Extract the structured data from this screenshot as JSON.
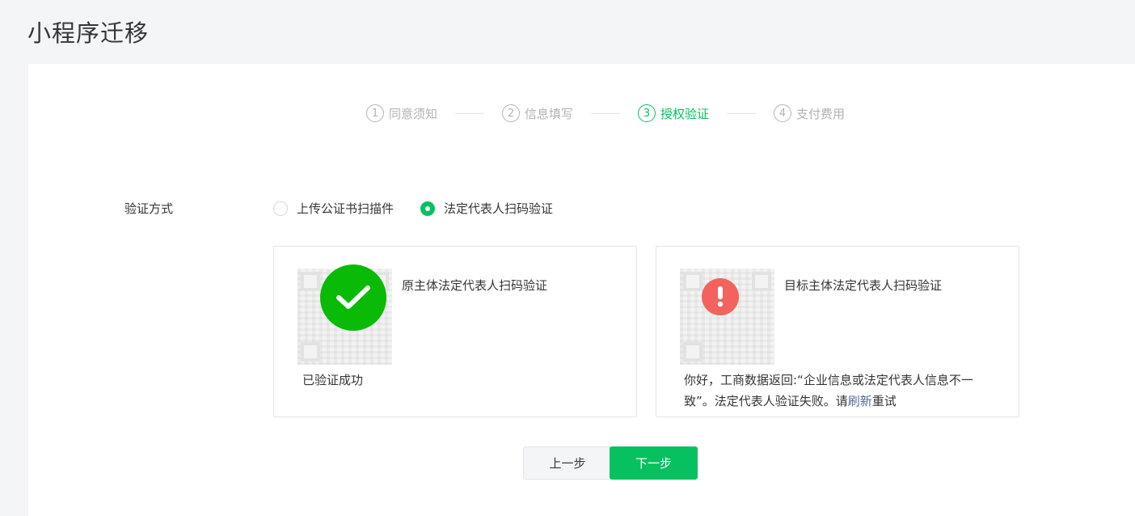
{
  "page": {
    "title": "小程序迁移"
  },
  "steps": [
    {
      "num": "1",
      "label": "同意须知"
    },
    {
      "num": "2",
      "label": "信息填写"
    },
    {
      "num": "3",
      "label": "授权验证"
    },
    {
      "num": "4",
      "label": "支付费用"
    }
  ],
  "active_step": 3,
  "form": {
    "label": "验证方式",
    "options": [
      {
        "label": "上传公证书扫描件",
        "selected": false
      },
      {
        "label": "法定代表人扫码验证",
        "selected": true
      }
    ]
  },
  "cards": {
    "original": {
      "title": "原主体法定代表人扫码验证",
      "status": "已验证成功",
      "icon": "success-check-icon"
    },
    "target": {
      "title": "目标主体法定代表人扫码验证",
      "message_before": "你好，工商数据返回:“企业信息或法定代表人信息不一致”。法定代表人验证失败。请",
      "message_link": "刷新",
      "message_after": "重试",
      "icon": "warning-icon"
    }
  },
  "buttons": {
    "prev": "上一步",
    "next": "下一步"
  },
  "colors": {
    "accent": "#07c160",
    "success": "#09bb07",
    "error": "#f2635f",
    "link": "#576b95"
  }
}
